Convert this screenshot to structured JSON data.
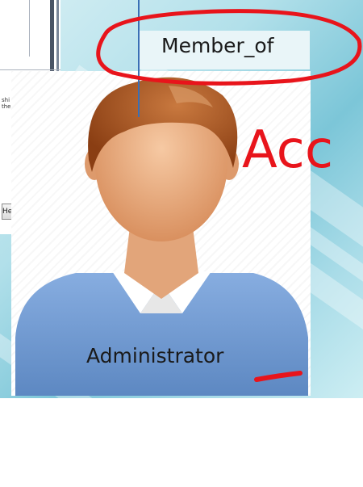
{
  "member_label": "Member_of",
  "admin_label": "Administrator",
  "handwritten_text": "Acc",
  "dialog": {
    "tiny_text_line1": "shi",
    "tiny_text_line2": "the",
    "button_label": "He"
  },
  "colors": {
    "annotation_red": "#e8141b",
    "connector_blue": "#3a6fb5",
    "shirt_blue": "#6c97cf"
  }
}
